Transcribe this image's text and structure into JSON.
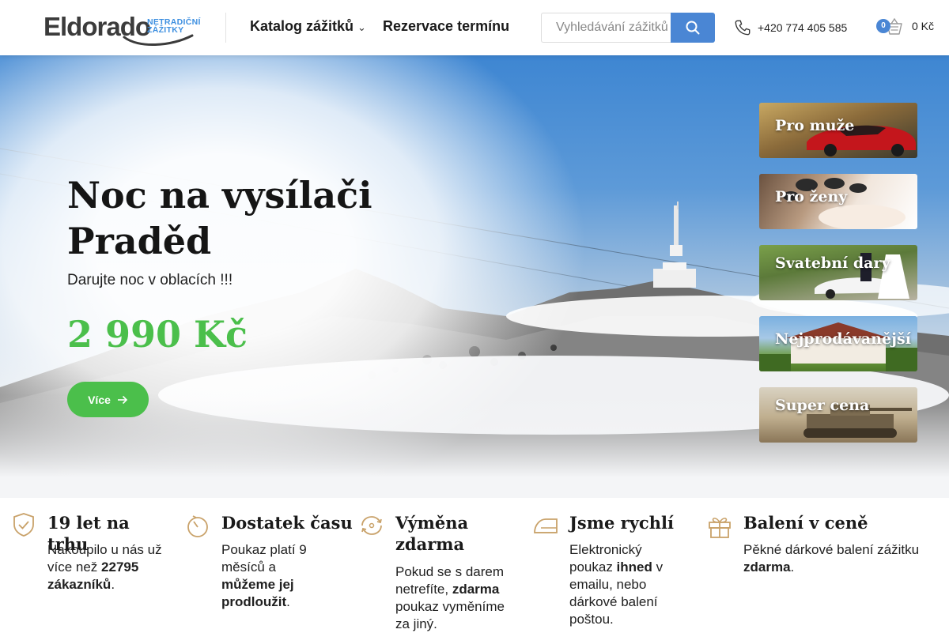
{
  "header": {
    "logo_word": "Eldorado",
    "logo_tag_1": "NETRADIČNÍ",
    "logo_tag_2": "ZÁŽITKY",
    "nav": {
      "catalog": "Katalog zážitků",
      "reservation": "Rezervace termínu"
    },
    "search_placeholder": "Vyhledávání zážitků",
    "phone": "+420 774 405 585",
    "cart_count": "0",
    "cart_total": "0 Kč"
  },
  "hero": {
    "title": "Noc na vysílači Praděd",
    "subtitle": "Darujte noc v oblacích !!!",
    "price": "2 990 Kč",
    "button": "Více"
  },
  "tiles": [
    {
      "label": "Pro muže"
    },
    {
      "label": "Pro ženy"
    },
    {
      "label": "Svatební dary"
    },
    {
      "label": "Nejprodávanější"
    },
    {
      "label": "Super cena"
    }
  ],
  "features": [
    {
      "title": "19 let na trhu",
      "text_a": "Nakoupilo u nás už více než ",
      "bold_a": "22795 zákazníků",
      "text_b": "."
    },
    {
      "title": "Dostatek času",
      "text_a": "Poukaz platí 9 měsíců a ",
      "bold_a": "můžeme jej prodloužit",
      "text_b": "."
    },
    {
      "title": "Výměna zdarma",
      "text_a": "Pokud se s darem netrefíte, ",
      "bold_a": "zdarma",
      "text_b": " poukaz vyměníme za jiný."
    },
    {
      "title": "Jsme rychlí",
      "text_a": "Elektronický poukaz ",
      "bold_a": "ihned",
      "text_b": " v emailu, nebo dárkové balení poštou."
    },
    {
      "title": "Balení v ceně",
      "text_a": "Pěkné dárkové balení zážitku ",
      "bold_a": "zdarma",
      "text_b": "."
    }
  ],
  "colors": {
    "accent_green": "#4bbf4b",
    "accent_blue": "#4a86d4",
    "feature_icon": "#c9a26a"
  }
}
